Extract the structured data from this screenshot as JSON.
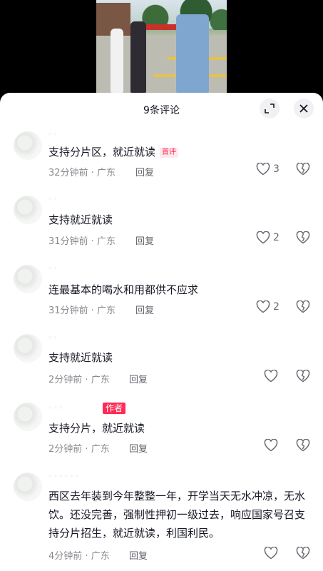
{
  "sheet": {
    "title": "9条评论"
  },
  "icons": {
    "expand": "expand-icon",
    "close": "close-icon",
    "like": "heart-outline-icon",
    "dislike": "broken-heart-icon"
  },
  "colors": {
    "accent": "#fe2c55",
    "text": "#161823",
    "meta": "#8a8b91"
  },
  "comments": [
    {
      "text": "支持分片区，就近就读",
      "first_badge": "首评",
      "time": "32分钟前",
      "region": "广东",
      "reply": "回复",
      "likes": "3"
    },
    {
      "text": "支持就近就读",
      "time": "31分钟前",
      "region": "广东",
      "reply": "回复",
      "likes": "2"
    },
    {
      "text": "连最基本的喝水和用都供不应求",
      "time": "31分钟前",
      "region": "广东",
      "reply": "回复",
      "likes": "2"
    },
    {
      "text": "支持就近就读",
      "time": "2分钟前",
      "region": "广东",
      "reply": "回复",
      "likes": ""
    },
    {
      "text": "支持分片，就近就读",
      "author_badge": "作者",
      "time": "2分钟前",
      "region": "广东",
      "reply": "回复",
      "likes": ""
    },
    {
      "text": "西区去年装到今年整整一年，开学当天无水冲凉，无水饮。还没完善，强制性押初一级过去，响应国家号召支持分片招生，就近就读，利国利民。",
      "time": "4分钟前",
      "region": "广东",
      "reply": "回复",
      "likes": ""
    }
  ]
}
